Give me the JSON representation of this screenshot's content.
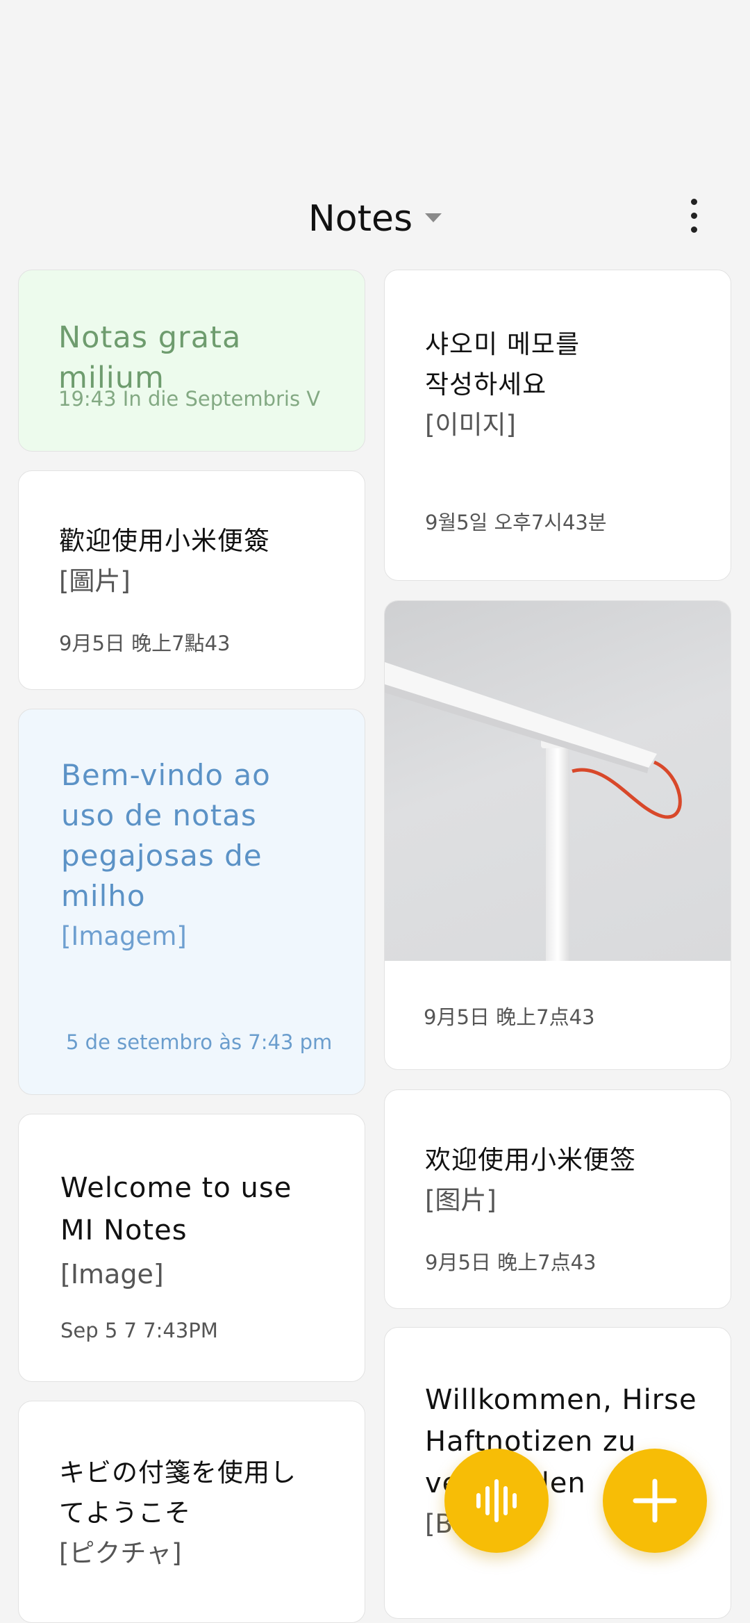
{
  "header": {
    "title": "Notes"
  },
  "notes_left": [
    {
      "title": "Notas grata milium",
      "image_label": "",
      "date": "19:43 In die Septembris V",
      "color": "#edfbed"
    },
    {
      "title": "歡迎使用小米便簽",
      "image_label": "[圖片]",
      "date": "9月5日 晚上7點43",
      "color": "#ffffff"
    },
    {
      "title_lines": [
        "Bem-vindo ao",
        "uso de notas",
        "pegajosas de",
        "milho"
      ],
      "image_label": "[Imagem]",
      "date": "5 de setembro às 7:43 pm",
      "color": "#f0f7fd"
    },
    {
      "title_lines": [
        "Welcome to use",
        "MI Notes"
      ],
      "image_label": "[Image]",
      "date": "Sep 5 7 7:43PM",
      "color": "#ffffff"
    },
    {
      "title_lines": [
        "キビの付箋を使用し",
        "てようこそ"
      ],
      "image_label": "[ピクチャ]",
      "date": "",
      "color": "#ffffff"
    }
  ],
  "notes_right": [
    {
      "title_lines": [
        "샤오미 메모를",
        "작성하세요"
      ],
      "image_label": "[이미지]",
      "date": "9월5일 오후7시43분",
      "color": "#ffffff"
    },
    {
      "photo": "desk-lamp-photo",
      "date": "9月5日 晚上7点43",
      "color": "#ffffff"
    },
    {
      "title": "欢迎使用小米便签",
      "image_label": "[图片]",
      "date": "9月5日 晚上7点43",
      "color": "#ffffff"
    },
    {
      "title_lines": [
        "Willkommen, Hirse",
        "Haftnotizen zu",
        "verwenden"
      ],
      "image_label": "[Bild]",
      "date": "",
      "color": "#ffffff"
    }
  ],
  "fab": {
    "voice_icon": "waveform-icon",
    "add_icon": "plus-icon",
    "color": "#f7bd06"
  }
}
